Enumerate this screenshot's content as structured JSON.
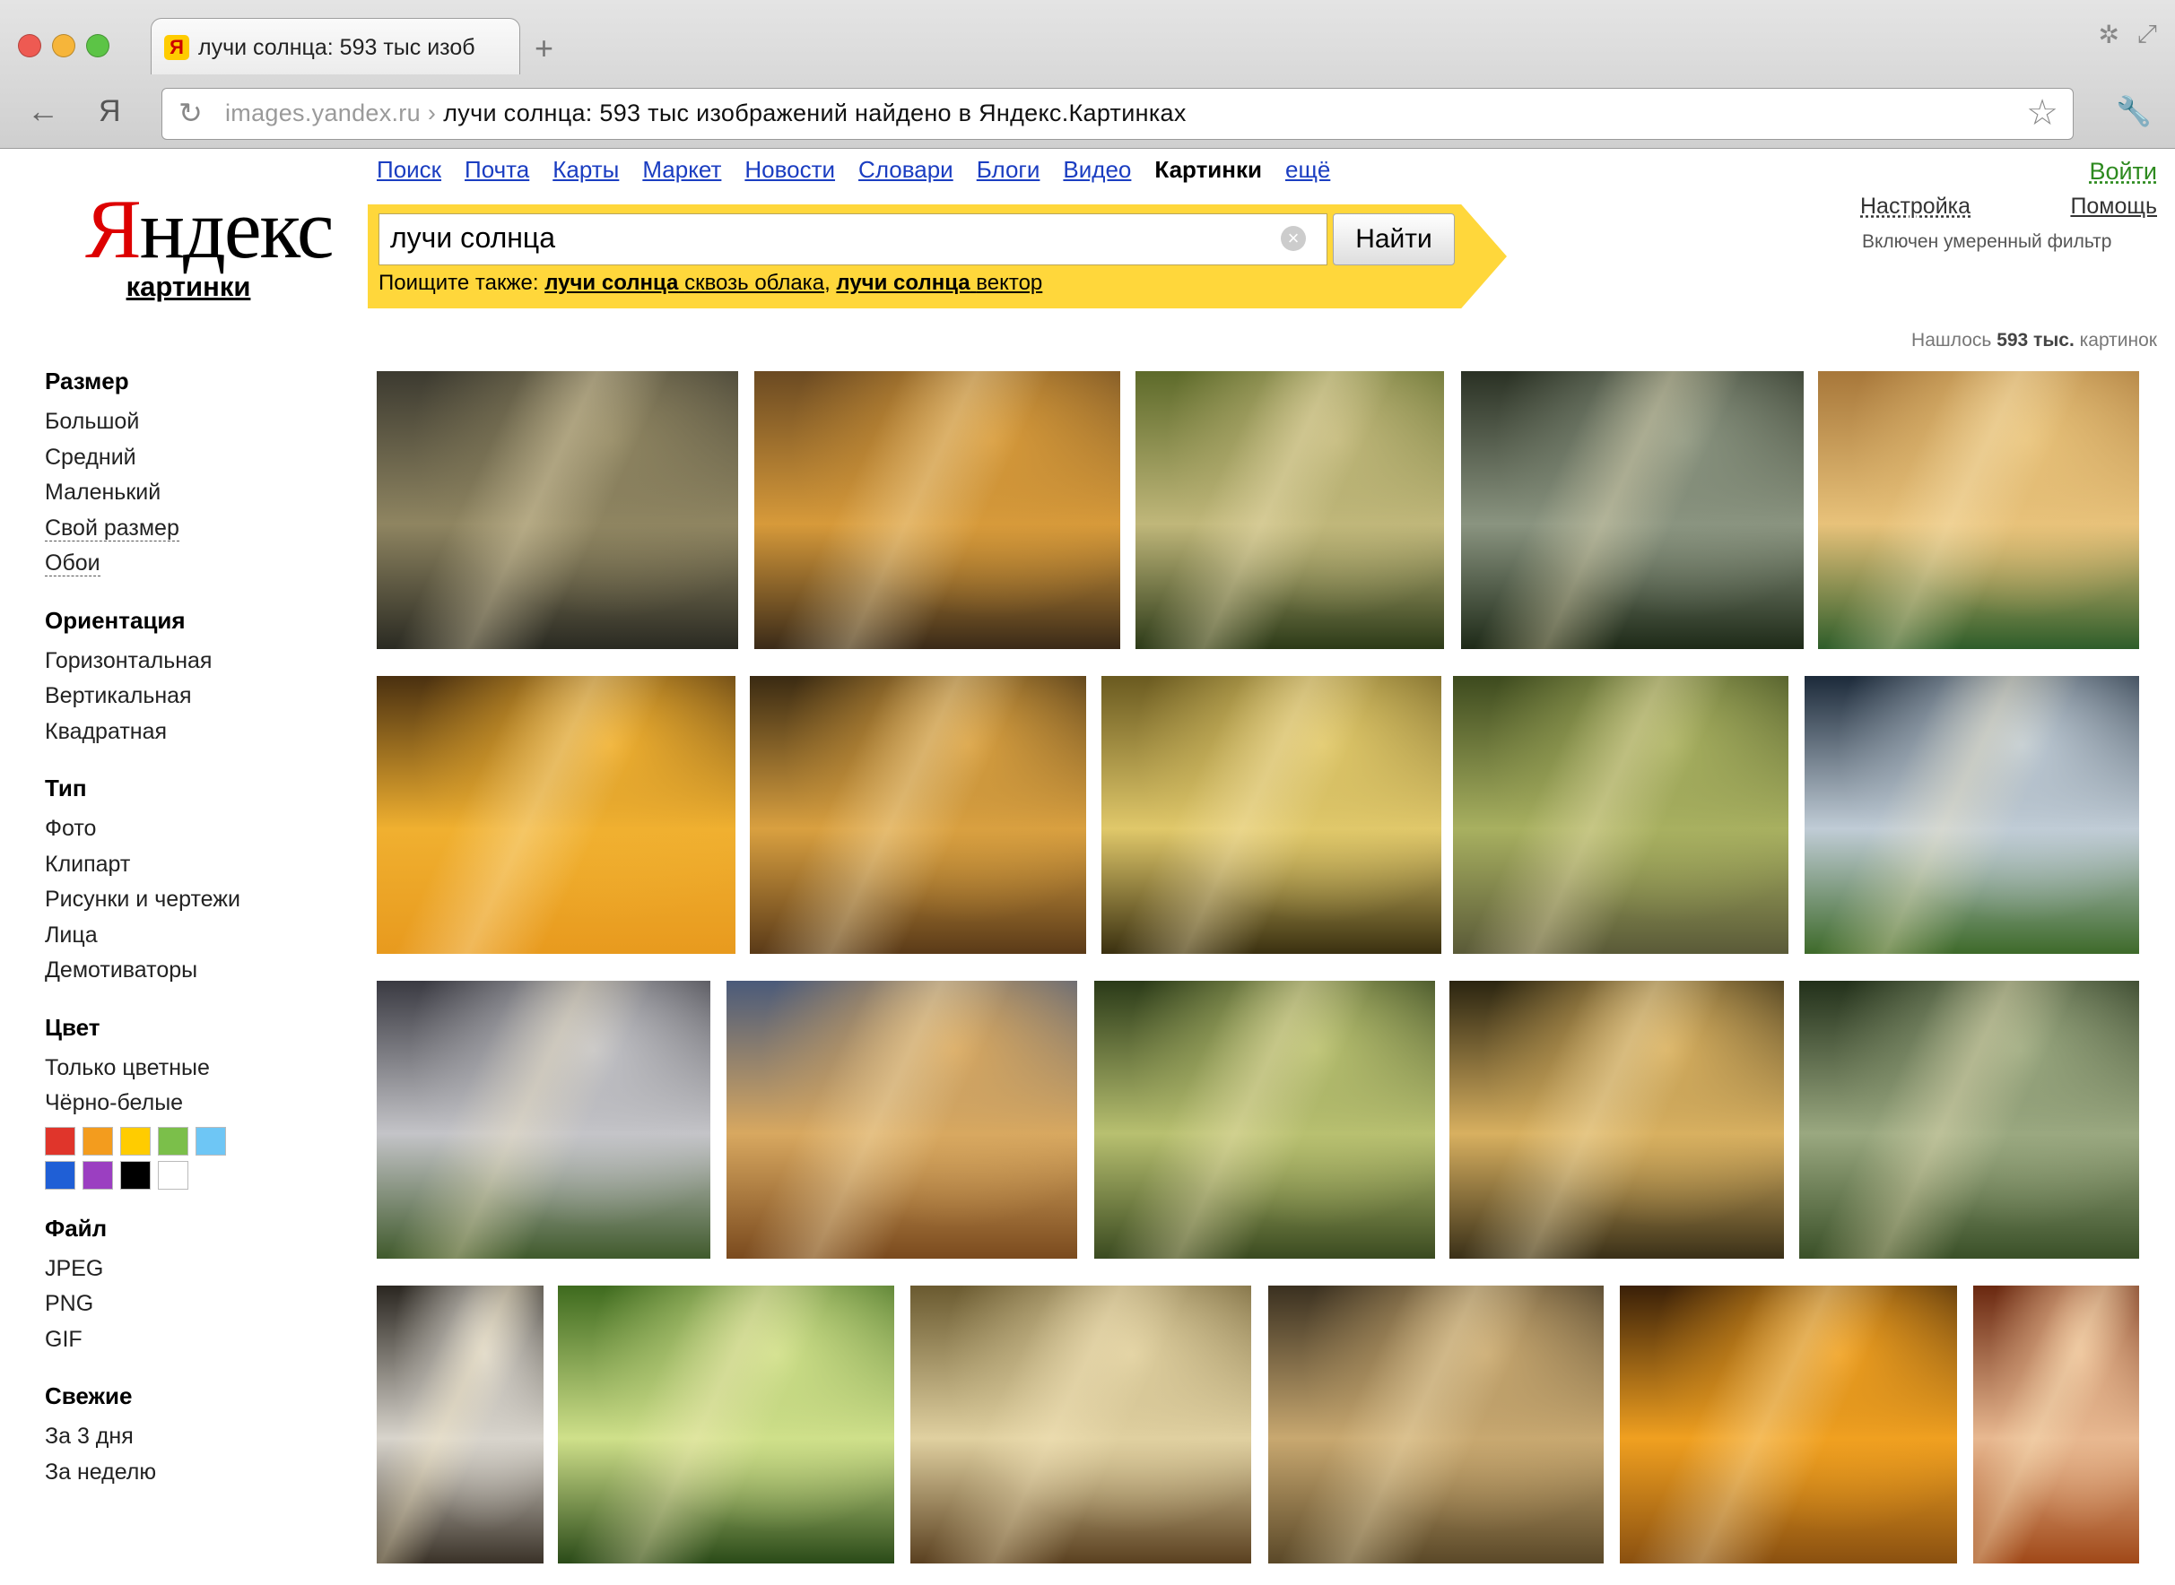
{
  "browser": {
    "tab_title": "лучи солнца: 593 тыс изоб",
    "new_tab": "+",
    "back": "←",
    "yandex_btn": "Я",
    "reload": "↻",
    "url_host": "images.yandex.ru",
    "url_sep": "›",
    "url_rest": "лучи солнца: 593 тыс изображений найдено в Яндекс.Картинках",
    "star": "☆",
    "wrench": "🔧",
    "settings_glyph": "✲",
    "resize_glyph": "⤢"
  },
  "header": {
    "logo_y": "Я",
    "logo_rest": "ндекс",
    "logo_sub": "картинки",
    "services": [
      "Поиск",
      "Почта",
      "Карты",
      "Маркет",
      "Новости",
      "Словари",
      "Блоги",
      "Видео"
    ],
    "current_service": "Картинки",
    "more": "ещё",
    "login": "Войти",
    "settings": "Настройка",
    "help": "Помощь",
    "filter_note": "Включен умеренный фильтр"
  },
  "search": {
    "query": "лучи солнца",
    "button": "Найти",
    "clear": "×",
    "also_label": "Поищите также:",
    "suggestions": [
      {
        "bold": "лучи солнца",
        "rest": "сквозь облака"
      },
      {
        "bold": "лучи солнца",
        "rest": "вектор"
      }
    ],
    "separator": ", "
  },
  "results": {
    "prefix": "Нашлось",
    "count": "593 тыс.",
    "suffix": "картинок"
  },
  "filters": [
    {
      "title": "Размер",
      "items": [
        "Большой",
        "Средний",
        "Маленький",
        "Свой размер",
        "Обои"
      ],
      "dotted": [
        3,
        4
      ]
    },
    {
      "title": "Ориентация",
      "items": [
        "Горизонтальная",
        "Вертикальная",
        "Квадратная"
      ],
      "dotted": []
    },
    {
      "title": "Тип",
      "items": [
        "Фото",
        "Клипарт",
        "Рисунки и чертежи",
        "Лица",
        "Демотиваторы"
      ],
      "dotted": []
    },
    {
      "title": "Цвет",
      "items": [
        "Только цветные",
        "Чёрно-белые"
      ],
      "dotted": []
    },
    {
      "title": "Файл",
      "items": [
        "JPEG",
        "PNG",
        "GIF"
      ],
      "dotted": []
    },
    {
      "title": "Свежие",
      "items": [
        "За 3 дня",
        "За неделю"
      ],
      "dotted": []
    }
  ],
  "color_swatches": [
    "#e0352b",
    "#f39c1e",
    "#ffcc00",
    "#7bbf4a",
    "#6ec6f5",
    "#1f5fd6",
    "#9b3fc1",
    "#000000",
    "#ffffff"
  ],
  "images": [
    {
      "name": "forest-rays-1",
      "colors": [
        "#3c3a30",
        "#8f8561",
        "#2a2a22"
      ]
    },
    {
      "name": "park-man-bench",
      "colors": [
        "#6b4a22",
        "#d79a3a",
        "#3a2a18"
      ]
    },
    {
      "name": "forest-path-green",
      "colors": [
        "#5d6a2a",
        "#c0b77a",
        "#2c3a18"
      ]
    },
    {
      "name": "dark-forest-rays",
      "colors": [
        "#2a3124",
        "#8a9480",
        "#1e2a18"
      ]
    },
    {
      "name": "meadow-rays",
      "colors": [
        "#a7773a",
        "#e8c27a",
        "#2e5d2a"
      ]
    },
    {
      "name": "golden-tree",
      "colors": [
        "#4a3010",
        "#f0b030",
        "#e89a1e"
      ]
    },
    {
      "name": "autumn-forest",
      "colors": [
        "#3a2a12",
        "#d9a040",
        "#5a3a18"
      ]
    },
    {
      "name": "forest-ferns",
      "colors": [
        "#6a5a20",
        "#e0c86a",
        "#3a3010"
      ]
    },
    {
      "name": "forest-road-rays",
      "colors": [
        "#3d4a1e",
        "#a8b060",
        "#5a5a38"
      ]
    },
    {
      "name": "clouds-over-fields",
      "colors": [
        "#1c2a3a",
        "#c0ccd6",
        "#3e6a2a"
      ]
    },
    {
      "name": "valley-clouds",
      "colors": [
        "#3a3a42",
        "#c4c4c8",
        "#405a2c"
      ]
    },
    {
      "name": "mountain-sunset",
      "colors": [
        "#4a5a7a",
        "#d8a860",
        "#7a4a1e"
      ]
    },
    {
      "name": "green-forest-path",
      "colors": [
        "#2a3a18",
        "#b8c070",
        "#3a4a20"
      ]
    },
    {
      "name": "tree-alley",
      "colors": [
        "#2a2410",
        "#d8b060",
        "#3a3018"
      ]
    },
    {
      "name": "jungle-rays",
      "colors": [
        "#22301a",
        "#9aa880",
        "#3a5028"
      ]
    },
    {
      "name": "cave-waterfall",
      "colors": [
        "#2a2620",
        "#d8d4cc",
        "#3a3228"
      ]
    },
    {
      "name": "spring-forest",
      "colors": [
        "#3e6a1e",
        "#cfe08a",
        "#2a4a18"
      ]
    },
    {
      "name": "autumn-road",
      "colors": [
        "#6a5a30",
        "#e0d0a0",
        "#5a4020"
      ]
    },
    {
      "name": "misty-lake-forest",
      "colors": [
        "#3a3020",
        "#c8a870",
        "#5a4828"
      ]
    },
    {
      "name": "sunset-lake",
      "colors": [
        "#3a2008",
        "#f0a020",
        "#8a5010"
      ]
    },
    {
      "name": "antelope-canyon",
      "colors": [
        "#6a2810",
        "#e8b890",
        "#a04818"
      ]
    }
  ]
}
